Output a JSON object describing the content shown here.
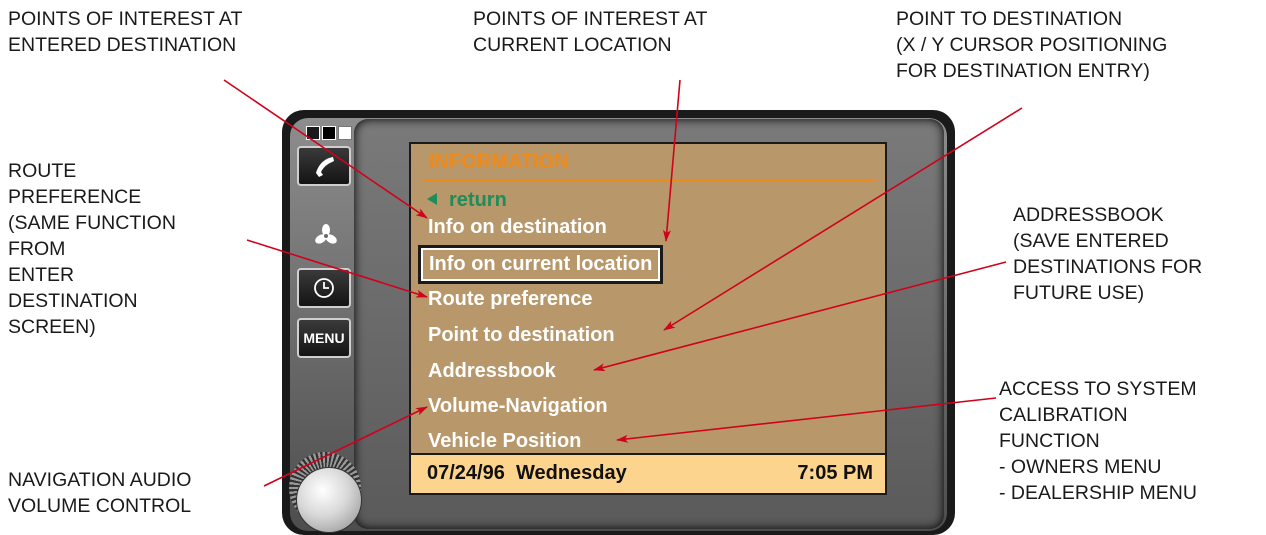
{
  "callouts": {
    "poi_destination": "POINTS OF INTEREST AT\nENTERED DESTINATION",
    "poi_current": "POINTS OF INTEREST AT\nCURRENT LOCATION",
    "point_to_destination": "POINT TO DESTINATION\n(X / Y CURSOR POSITIONING\nFOR DESTINATION ENTRY)",
    "route_preference": "ROUTE\nPREFERENCE\n(SAME FUNCTION\nFROM\nENTER\nDESTINATION\nSCREEN)",
    "addressbook": "ADDRESSBOOK\n(SAVE ENTERED\nDESTINATIONS FOR\nFUTURE USE)",
    "calibration": "ACCESS TO SYSTEM\nCALIBRATION\nFUNCTION\n- OWNERS MENU\n- DEALERSHIP MENU",
    "nav_volume": "NAVIGATION AUDIO\nVOLUME CONTROL"
  },
  "screen": {
    "title": "INFORMATION",
    "return_label": "return",
    "items": [
      "Info on destination",
      "Info on current location",
      "Route preference",
      "Point to destination",
      "Addressbook",
      "Volume-Navigation",
      "Vehicle Position"
    ],
    "selected_item": "Info on current location",
    "status_date": "07/24/96  Wednesday",
    "status_time": "7:05 PM"
  },
  "side_buttons": {
    "menu_label": "MENU",
    "phone_icon": "phone-icon",
    "fan_icon": "fan-icon",
    "clock_icon": "clock-icon"
  },
  "colors": {
    "screen_background": "#b8986a",
    "title_orange": "#ee8a1a",
    "return_green": "#1f8c5a",
    "status_bar": "#fdd48e",
    "arrow_red": "#d0021b"
  }
}
